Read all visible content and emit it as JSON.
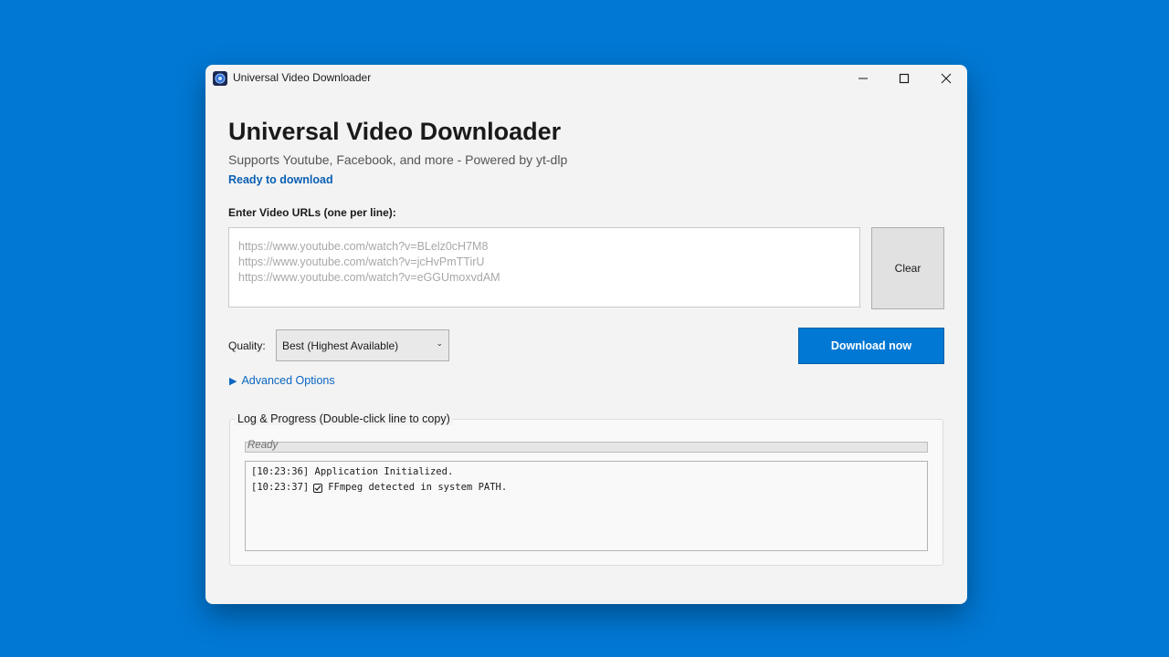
{
  "window": {
    "title": "Universal Video Downloader",
    "controls": [
      "minimize-icon",
      "maximize-icon",
      "close-icon"
    ]
  },
  "header": {
    "title": "Universal Video Downloader",
    "subtitle": "Supports Youtube, Facebook, and more - Powered by yt-dlp",
    "status": "Ready to download"
  },
  "urls": {
    "label": "Enter Video URLs (one per line):",
    "placeholder_lines": [
      "https://www.youtube.com/watch?v=BLelz0cH7M8",
      "https://www.youtube.com/watch?v=jcHvPmTTirU",
      "https://www.youtube.com/watch?v=eGGUmoxvdAM"
    ],
    "clear_label": "Clear"
  },
  "quality": {
    "label": "Quality:",
    "selected": "Best (Highest Available)"
  },
  "download_label": "Download now",
  "advanced_label": "Advanced Options",
  "log": {
    "group_title": "Log & Progress (Double-click line to copy)",
    "progress_text": "Ready",
    "progress_value": 0,
    "entries": [
      {
        "time": "[10:23:36]",
        "icon": "",
        "text": "Application Initialized."
      },
      {
        "time": "[10:23:37]",
        "icon": "checkbox-icon",
        "text": "FFmpeg detected in system PATH."
      }
    ]
  },
  "colors": {
    "desktop": "#0078d4",
    "accent": "#0078d4",
    "status": "#0a5fb4"
  }
}
